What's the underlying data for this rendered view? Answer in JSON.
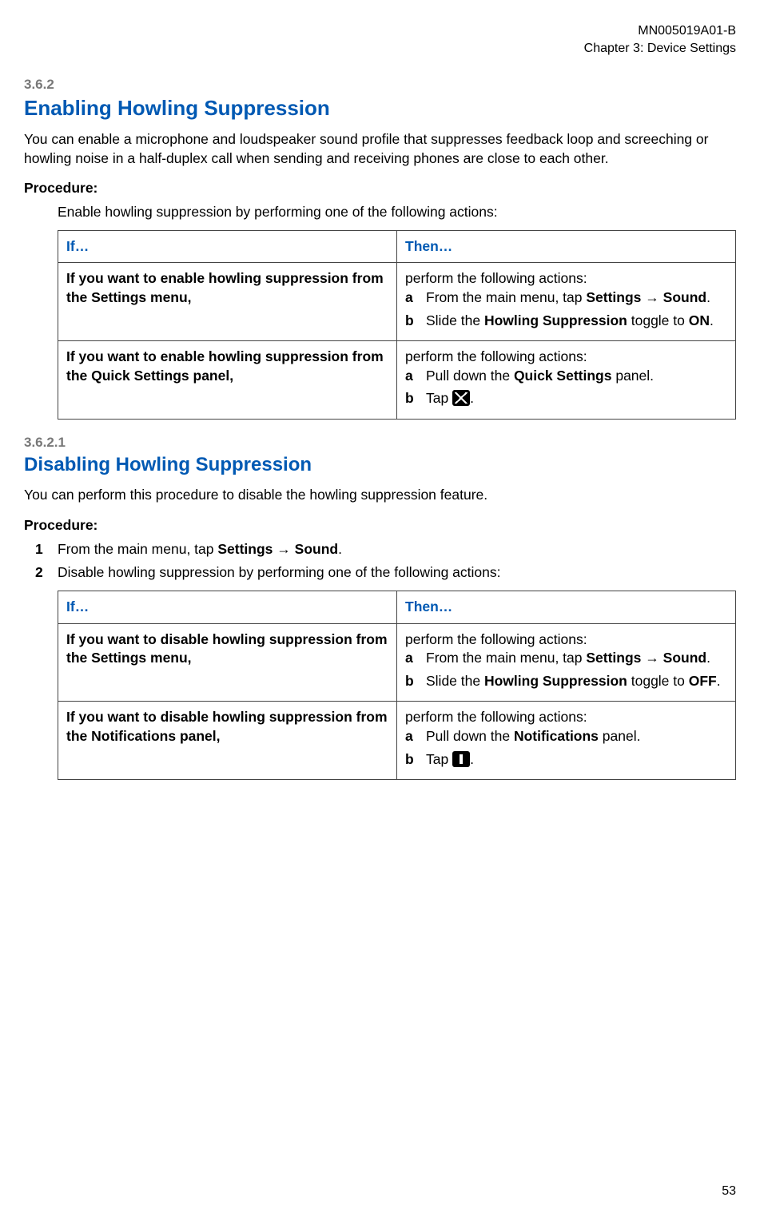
{
  "header": {
    "doc_id": "MN005019A01-B",
    "chapter": "Chapter 3:  Device Settings"
  },
  "section1": {
    "num": "3.6.2",
    "title": "Enabling Howling Suppression",
    "intro": "You can enable a microphone and loudspeaker sound profile that suppresses feedback loop and screeching or howling noise in a half-duplex call when sending and receiving phones are close to each other.",
    "proc_label": "Procedure:",
    "proc_action": "Enable howling suppression by performing one of the following actions:",
    "table": {
      "h_if": "If…",
      "h_then": "Then…",
      "rows": [
        {
          "if": "If you want to enable howling suppres­sion from the Settings menu,",
          "then_lead": "perform the following actions:",
          "steps": [
            {
              "marker": "a",
              "pre": "From the main menu, tap ",
              "b1": "Settings",
              "arrow": " → ",
              "b2": "Sound",
              "post": "."
            },
            {
              "marker": "b",
              "pre": "Slide the ",
              "b1": "Howling Suppression",
              "mid": " toggle to ",
              "b2": "ON",
              "post": "."
            }
          ]
        },
        {
          "if": "If you want to enable howling suppres­sion from the Quick Settings panel,",
          "then_lead": "perform the following actions:",
          "steps": [
            {
              "marker": "a",
              "pre": "Pull down the ",
              "b1": "Quick Settings",
              "post": " panel."
            },
            {
              "marker": "b",
              "pre": "Tap ",
              "icon": "howling-suppression-icon",
              "post": "."
            }
          ]
        }
      ]
    }
  },
  "section2": {
    "num": "3.6.2.1",
    "title": "Disabling Howling Suppression",
    "intro": "You can perform this procedure to disable the howling suppression feature.",
    "proc_label": "Procedure:",
    "steps": [
      {
        "marker": "1",
        "pre": "From the main menu, tap ",
        "b1": "Settings",
        "arrow": " → ",
        "b2": "Sound",
        "post": "."
      },
      {
        "marker": "2",
        "text": "Disable howling suppression by performing one of the following actions:"
      }
    ],
    "table": {
      "h_if": "If…",
      "h_then": "Then…",
      "rows": [
        {
          "if": "If you want to disable howling suppres­sion from the Settings menu,",
          "then_lead": "perform the following actions:",
          "steps": [
            {
              "marker": "a",
              "pre": "From the main menu, tap ",
              "b1": "Settings",
              "arrow": " → ",
              "b2": "Sound",
              "post": "."
            },
            {
              "marker": "b",
              "pre": "Slide the ",
              "b1": "Howling Suppression",
              "mid": " toggle to ",
              "b2": "OFF",
              "post": "."
            }
          ]
        },
        {
          "if": "If you want to disable howling suppres­sion from the Notifications panel,",
          "then_lead": "perform the following actions:",
          "steps": [
            {
              "marker": "a",
              "pre": "Pull down the ",
              "b1": "Notifications",
              "post": " panel."
            },
            {
              "marker": "b",
              "pre": "Tap ",
              "icon": "howling-suppression-off-icon",
              "post": "."
            }
          ]
        }
      ]
    }
  },
  "page_number": "53"
}
